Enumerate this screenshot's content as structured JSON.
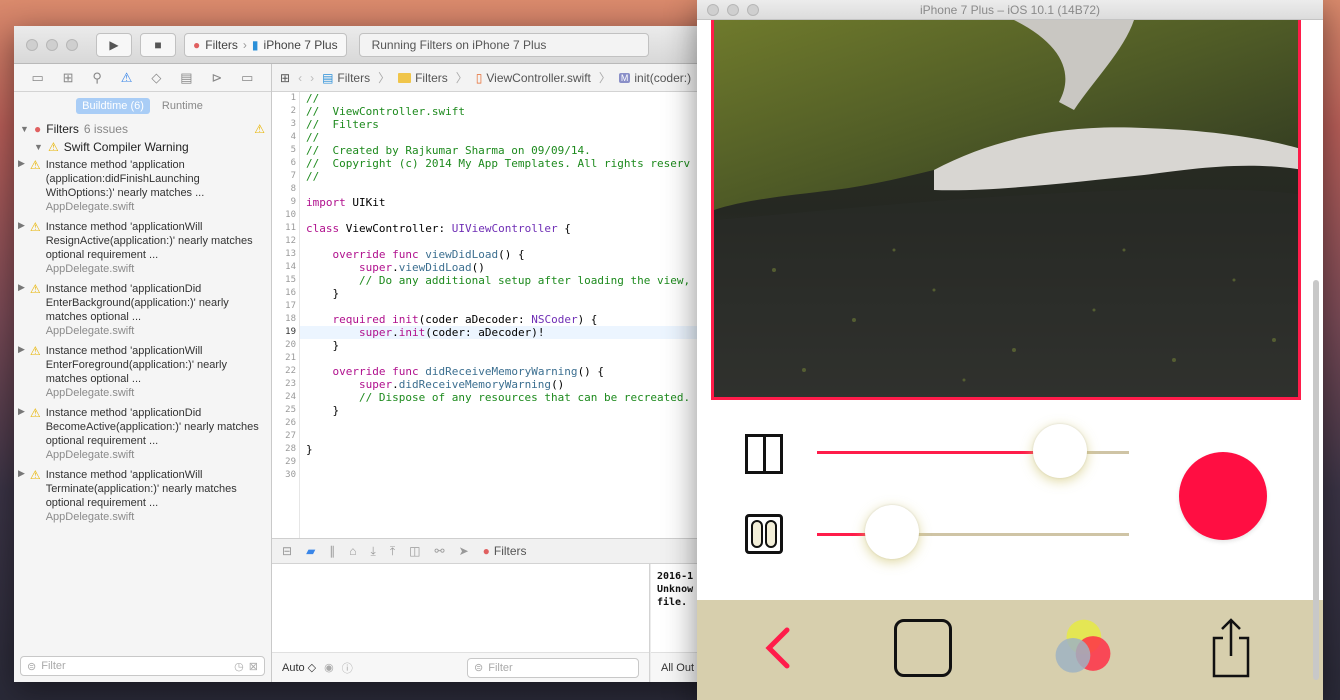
{
  "xcode": {
    "toolbar": {
      "scheme_app": "Filters",
      "scheme_device": "iPhone 7 Plus",
      "activity_text": "Running Filters on iPhone 7 Plus"
    },
    "navigator": {
      "tabs": {
        "buildtime": "Buildtime (6)",
        "runtime": "Runtime"
      },
      "root_label": "Filters",
      "root_count": "6 issues",
      "group_label": "Swift Compiler Warning",
      "issues": [
        {
          "text": "Instance method 'application (application:didFinishLaunching WithOptions:)' nearly matches ...",
          "file": "AppDelegate.swift"
        },
        {
          "text": "Instance method 'applicationWill ResignActive(application:)' nearly matches optional requirement ...",
          "file": "AppDelegate.swift"
        },
        {
          "text": "Instance method 'applicationDid EnterBackground(application:)' nearly matches optional ...",
          "file": "AppDelegate.swift"
        },
        {
          "text": "Instance method 'applicationWill EnterForeground(application:)' nearly matches optional ...",
          "file": "AppDelegate.swift"
        },
        {
          "text": "Instance method 'applicationDid BecomeActive(application:)' nearly matches optional requirement ...",
          "file": "AppDelegate.swift"
        },
        {
          "text": "Instance method 'applicationWill Terminate(application:)' nearly matches optional requirement ...",
          "file": "AppDelegate.swift"
        }
      ],
      "filter_placeholder": "Filter"
    },
    "jumpbar": {
      "project": "Filters",
      "folder": "Filters",
      "file": "ViewController.swift",
      "symbol_badge": "M",
      "symbol": "init(coder:)"
    },
    "editor": {
      "current_line": 19,
      "lines": [
        "//",
        "//  ViewController.swift",
        "//  Filters",
        "//",
        "//  Created by Rajkumar Sharma on 09/09/14.",
        "//  Copyright (c) 2014 My App Templates. All rights reserv",
        "//",
        "",
        "import UIKit",
        "",
        "class ViewController: UIViewController {",
        "",
        "    override func viewDidLoad() {",
        "        super.viewDidLoad()",
        "        // Do any additional setup after loading the view,",
        "    }",
        "",
        "    required init(coder aDecoder: NSCoder) {",
        "        super.init(coder: aDecoder)!",
        "    }",
        "",
        "    override func didReceiveMemoryWarning() {",
        "        super.didReceiveMemoryWarning()",
        "        // Dispose of any resources that can be recreated.",
        "    }",
        "",
        "",
        "}",
        "",
        ""
      ]
    },
    "debug": {
      "process_label": "Filters",
      "console_output": "2016-1\nUnknow\nfile.",
      "auto_label": "Auto ◇",
      "filter_placeholder": "Filter",
      "all_output_label": "All Out"
    }
  },
  "simulator": {
    "title": "iPhone 7 Plus – iOS 10.1 (14B72)",
    "slider1_value": 0.78,
    "slider2_value": 0.24,
    "accent_color": "#ff1c4a",
    "tabbar_color": "#d7cfad",
    "tabs": [
      "back-icon",
      "frame-icon",
      "color-filter-icon",
      "share-icon"
    ]
  }
}
